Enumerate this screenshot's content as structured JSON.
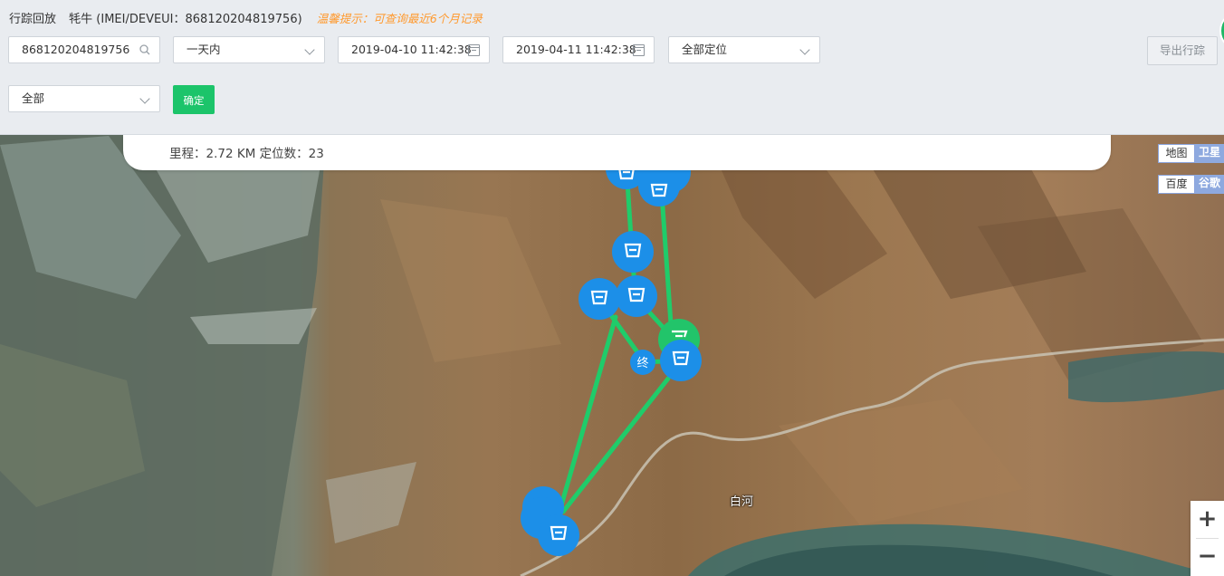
{
  "header": {
    "title": "行踪回放",
    "device": "牦牛 (IMEI/DEVEUI：868120204819756)",
    "hint": "温馨提示：可查询最近6个月记录"
  },
  "filters": {
    "search_value": "868120204819756",
    "range_select": "一天内",
    "start_time": "2019-04-10 11:42:38",
    "end_time": "2019-04-11 11:42:38",
    "locate_select": "全部定位",
    "type_select": "全部",
    "confirm_label": "确定",
    "export_label": "导出行踪"
  },
  "info": {
    "summary": "里程：2.72 KM 定位数：23"
  },
  "map": {
    "type_map": "地图",
    "type_satellite": "卫星",
    "src_baidu": "百度",
    "src_google": "谷歌",
    "zoom_in": "+",
    "zoom_out": "−",
    "river_label": "白河",
    "end_marker": "终",
    "route_color": "#1fcc6a",
    "marker_color": "#1c8fe8",
    "start_marker_color": "#22c46a"
  }
}
